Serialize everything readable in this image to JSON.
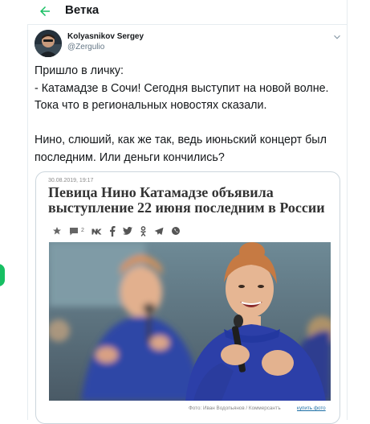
{
  "header": {
    "title": "Ветка"
  },
  "tweet": {
    "author_name": "Kolyasnikov Sergey",
    "author_handle": "@Zergulio",
    "text": "Пришло в личку:\n- Катамадзе в Сочи! Сегодня выступит на новой волне. Тока что в региональных новостях сказали.\n\nНино, слюший, как же так, ведь июньский концерт был последним. Или деньги кончились?",
    "card": {
      "date": "30.08.2019, 19:17",
      "title": "Певица Нино Катамадзе объявила выступление 22 июня последним в России",
      "comment_count": "2",
      "photo_credit": "Фото: Иван Водопьянов / Коммерсантъ",
      "buy_photo": "купить фото"
    }
  },
  "colors": {
    "accent": "#17bf63",
    "text": "#14171a",
    "muted": "#657786",
    "border": "#e6ecf0"
  },
  "icons": [
    "back-arrow-icon",
    "chevron-down-icon",
    "bookmark-star-icon",
    "comment-icon",
    "vk-icon",
    "facebook-icon",
    "twitter-icon",
    "odnoklassniki-icon",
    "telegram-icon",
    "whatsapp-icon"
  ]
}
